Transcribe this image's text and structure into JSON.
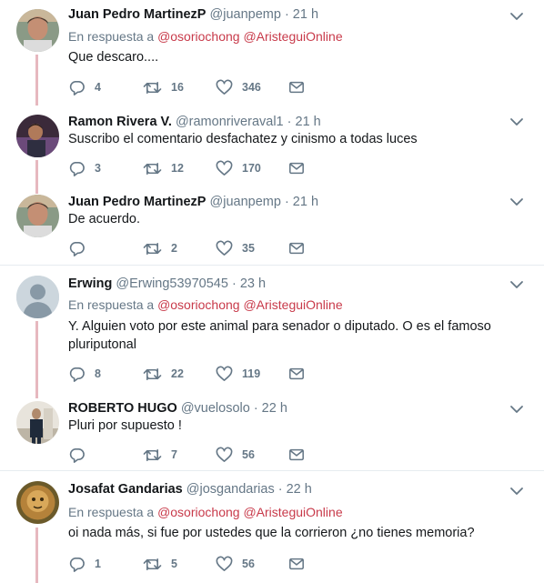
{
  "tweets": [
    {
      "name": "Juan Pedro MartinezP",
      "handle": "@juanpemp",
      "time": "· 21 h",
      "reply_prefix": "En respuesta a",
      "reply_mentions": [
        "@osoriochong",
        "@AristeguiOnline"
      ],
      "text": "Que descaro....",
      "replies": "4",
      "retweets": "16",
      "likes": "346"
    },
    {
      "name": "Ramon Rivera V.",
      "handle": "@ramonriveraval1",
      "time": "· 21 h",
      "text": "Suscribo el comentario desfachatez y cinismo a todas luces",
      "replies": "3",
      "retweets": "12",
      "likes": "170"
    },
    {
      "name": "Juan Pedro MartinezP",
      "handle": "@juanpemp",
      "time": "· 21 h",
      "text": "De acuerdo.",
      "replies": "",
      "retweets": "2",
      "likes": "35"
    },
    {
      "name": "Erwing",
      "handle": "@Erwing53970545",
      "time": "· 23 h",
      "reply_prefix": "En respuesta a",
      "reply_mentions": [
        "@osoriochong",
        "@AristeguiOnline"
      ],
      "text_lines": [
        "Y. Alguien voto por este animal para senador o diputado. O es el famoso",
        "pluriputonal"
      ],
      "replies": "8",
      "retweets": "22",
      "likes": "119"
    },
    {
      "name": "ROBERTO HUGO",
      "handle": "@vuelosolo",
      "time": "· 22 h",
      "text": "Pluri por supuesto !",
      "replies": "",
      "retweets": "7",
      "likes": "56"
    },
    {
      "name": "Josafat Gandarias",
      "handle": "@josgandarias",
      "time": "· 22 h",
      "reply_prefix": "En respuesta a",
      "reply_mentions": [
        "@osoriochong",
        "@AristeguiOnline"
      ],
      "text": "oi nada más, si fue por ustedes que la corrieron ¿no tienes memoria?",
      "replies": "1",
      "retweets": "5",
      "likes": "56"
    }
  ],
  "icons": {
    "reply": "reply-icon",
    "retweet": "retweet-icon",
    "like": "heart-icon",
    "dm": "envelope-icon",
    "more": "chevron-down-icon"
  },
  "colors": {
    "mention": "#c83a4a",
    "thread_line": "#e6b8bf",
    "icon": "#657786"
  }
}
